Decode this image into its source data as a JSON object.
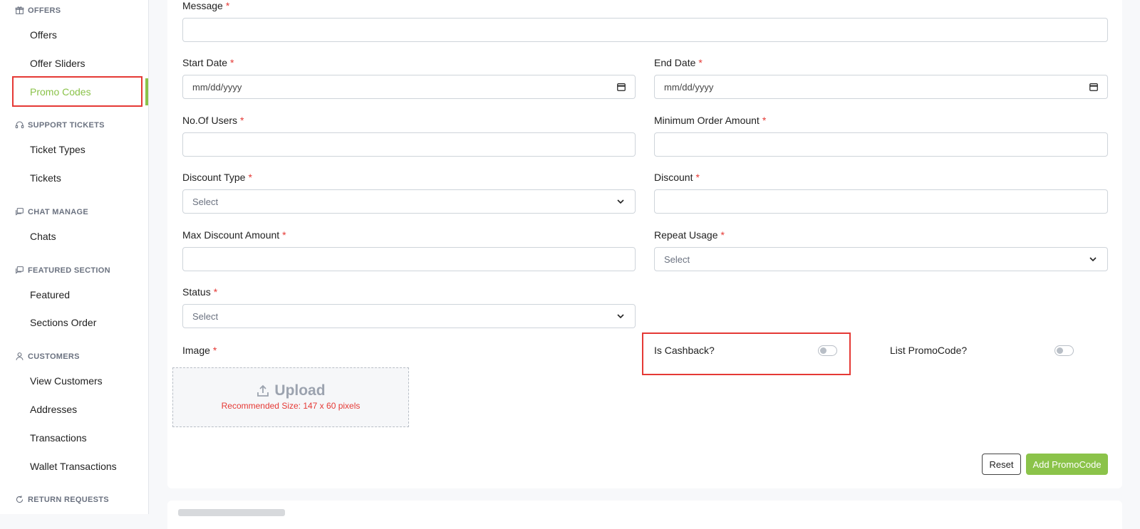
{
  "sidebar": {
    "offers_section": "OFFERS",
    "offers": "Offers",
    "offer_sliders": "Offer Sliders",
    "promo_codes": "Promo Codes",
    "support_section": "SUPPORT TICKETS",
    "ticket_types": "Ticket Types",
    "tickets": "Tickets",
    "chat_section": "CHAT MANAGE",
    "chats": "Chats",
    "featured_section": "FEATURED SECTION",
    "featured": "Featured",
    "sections_order": "Sections Order",
    "customers_section": "CUSTOMERS",
    "view_customers": "View Customers",
    "addresses": "Addresses",
    "transactions": "Transactions",
    "wallet_transactions": "Wallet Transactions",
    "return_section": "RETURN REQUESTS"
  },
  "form": {
    "required_mark": "*",
    "message_label": "Message",
    "message_value": "",
    "start_date_label": "Start Date",
    "start_date_placeholder": "mm/dd/yyyy",
    "end_date_label": "End Date",
    "end_date_placeholder": "mm/dd/yyyy",
    "users_label": "No.Of Users",
    "min_order_label": "Minimum Order Amount",
    "discount_type_label": "Discount Type",
    "discount_type_value": "Select",
    "discount_label": "Discount",
    "max_discount_label": "Max Discount Amount",
    "repeat_usage_label": "Repeat Usage",
    "repeat_usage_value": "Select",
    "status_label": "Status",
    "status_value": "Select",
    "image_label": "Image",
    "upload_title": "Upload",
    "upload_hint": "Recommended Size: 147 x 60 pixels",
    "is_cashback_label": "Is Cashback?",
    "is_cashback_on": false,
    "list_promocode_label": "List PromoCode?",
    "list_promocode_on": false
  },
  "actions": {
    "reset": "Reset",
    "add": "Add PromoCode"
  },
  "colors": {
    "accent": "#8bc34a",
    "required": "#e53935",
    "highlight": "#e53935"
  }
}
